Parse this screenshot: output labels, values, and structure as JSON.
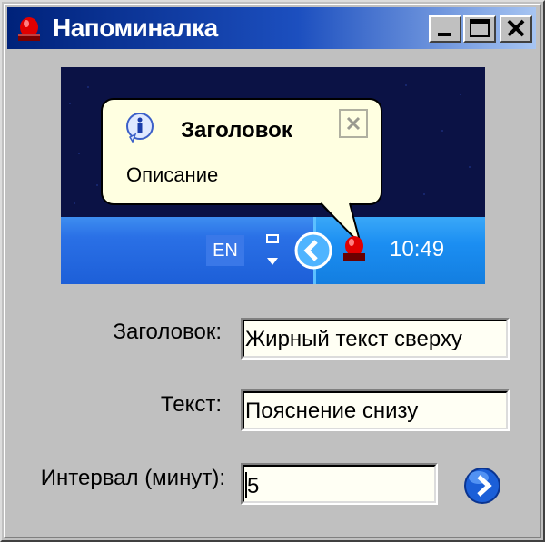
{
  "window": {
    "title": "Напоминалка",
    "icon": "red-siren-icon",
    "buttons": [
      "minimize-icon",
      "maximize-icon",
      "close-icon"
    ]
  },
  "preview": {
    "balloon": {
      "icon": "info-icon",
      "title": "Заголовок",
      "description": "Описание",
      "close_icon": "close-icon"
    },
    "taskbar": {
      "language": "EN",
      "clock": "10:49",
      "tray_icons": [
        "network-icon",
        "collapse-arrow-icon",
        "red-siren-icon"
      ]
    }
  },
  "form": {
    "title_label": "Заголовок:",
    "title_value": "Жирный текст сверху",
    "text_label": "Текст:",
    "text_value": "Пояснение снизу",
    "interval_label": "Интервал (минут):",
    "interval_value": "5",
    "go_button_icon": "arrow-right-icon"
  },
  "colors": {
    "titlebar_start": "#00227a",
    "titlebar_end": "#a7c5f2",
    "window_bg": "#c0c0c0",
    "balloon_bg": "#ffffe1",
    "taskbar": "#2a70e6"
  }
}
